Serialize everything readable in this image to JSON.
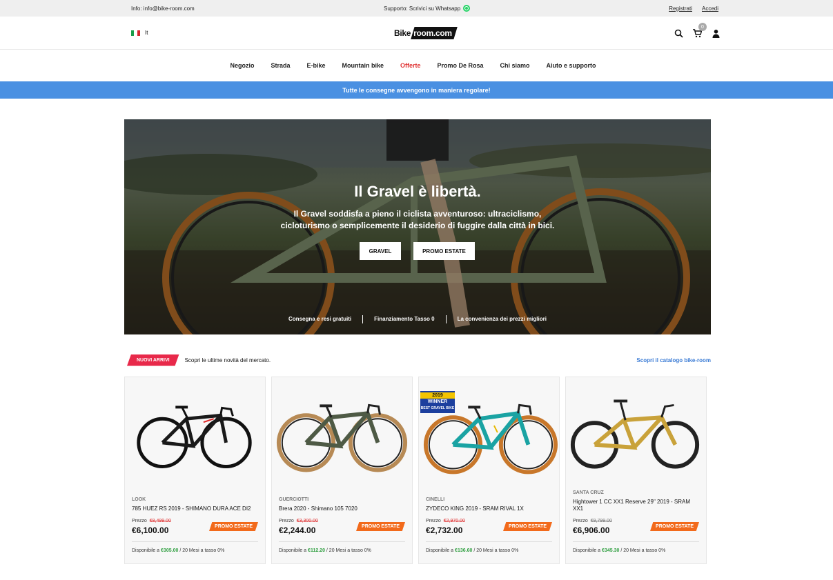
{
  "topbar": {
    "info": "Info: info@bike-room.com",
    "support": "Supporto: Scrivici su Whatsapp",
    "register": "Registrati",
    "login": "Accedi"
  },
  "header": {
    "lang": "It",
    "logo_left": "Bike",
    "logo_right": "room.com",
    "cart_count": "0"
  },
  "nav": {
    "items": [
      "Negozio",
      "Strada",
      "E-bike",
      "Mountain bike",
      "Offerte",
      "Promo De Rosa",
      "Chi siamo",
      "Aiuto e supporto"
    ]
  },
  "notice": "Tutte le consegne avvengono in maniera regolare!",
  "hero": {
    "title": "Il Gravel è libertà.",
    "subtitle": "Il Gravel soddisfa a pieno il ciclista avventuroso: ultraciclismo, cicloturismo o semplicemente il desiderio di fuggire dalla città in bici.",
    "btn1": "GRAVEL",
    "btn2": "PROMO ESTATE",
    "features": [
      "Consegna e resi gratuiti",
      "Finanziamento Tasso 0",
      "La convenienza dei prezzi migliori"
    ]
  },
  "section": {
    "tag": "NUOVI ARRIVI",
    "desc": "Scopri le ultime novità del mercato.",
    "link": "Scopri il catalogo bike-room"
  },
  "products": [
    {
      "brand": "LOOK",
      "name": "785 HUEZ RS 2019 - SHIMANO DURA ACE DI2",
      "price_label": "Prezzo",
      "old_price": "€8,499.00",
      "price": "€6,100.00",
      "promo": "PROMO ESTATE",
      "avail_prefix": "Disponibile a",
      "avail_amount": "€305.00",
      "avail_suffix": "/ 20 Mesi a tasso 0%"
    },
    {
      "brand": "GUERCIOTTI",
      "name": "Brera 2020 - Shimano 105 7020",
      "price_label": "Prezzo",
      "old_price": "€3,300.00",
      "price": "€2,244.00",
      "promo": "PROMO ESTATE",
      "avail_prefix": "Disponibile a",
      "avail_amount": "€112.20",
      "avail_suffix": "/ 20 Mesi a tasso 0%"
    },
    {
      "brand": "CINELLI",
      "name": "ZYDECO KING 2019 - SRAM RIVAL 1X",
      "price_label": "Prezzo",
      "old_price": "€2,970.00",
      "price": "€2,732.00",
      "promo": "PROMO ESTATE",
      "avail_prefix": "Disponibile a",
      "avail_amount": "€136.60",
      "avail_suffix": "/ 20 Mesi a tasso 0%",
      "award": {
        "year": "2019",
        "title": "WINNER",
        "sub": "BEST GRAVEL BIKE"
      }
    },
    {
      "brand": "SANTA CRUZ",
      "name": "Hightower 1 CC XX1 Reserve 29\" 2019 - SRAM XX1",
      "price_label": "Prezzo",
      "old_price": "€9,799.00",
      "price": "€6,906.00",
      "promo": "PROMO ESTATE",
      "avail_prefix": "Disponibile a",
      "avail_amount": "€345.30",
      "avail_suffix": "/ 20 Mesi a tasso 0%"
    }
  ],
  "colors": {
    "notice_bg": "#4a90e2",
    "tag_bg": "#e8294a",
    "promo_bg": "#f26a1b",
    "active_nav": "#e03333",
    "old_price": "#e03333",
    "avail_amount": "#2e9e3f"
  }
}
